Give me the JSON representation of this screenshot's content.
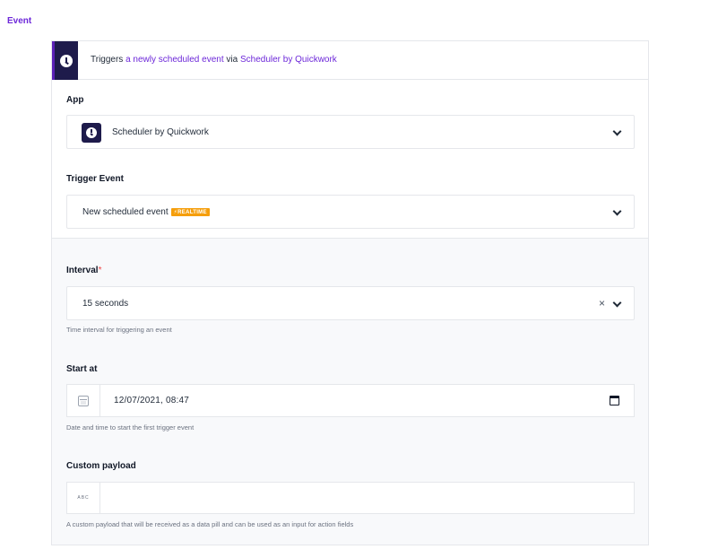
{
  "section_title": "Event",
  "trigger_header": {
    "prefix": "Triggers",
    "event_link": "a newly scheduled event",
    "via": "via",
    "app_link": "Scheduler by Quickwork",
    "logo_icon": "clock-icon"
  },
  "app": {
    "label": "App",
    "value": "Scheduler by Quickwork",
    "logo_icon": "clock-icon"
  },
  "trigger_event": {
    "label": "Trigger Event",
    "value": "New scheduled event",
    "badge": "REALTIME",
    "badge_icon": "lightning-icon",
    "badge_color": "#f59e0b"
  },
  "interval": {
    "label": "Interval",
    "required_mark": "*",
    "value": "15 seconds",
    "clear": "×",
    "help": "Time interval for triggering an event"
  },
  "start_at": {
    "label": "Start at",
    "value": "12/07/2021, 08:47",
    "help": "Date and time to start the first trigger event"
  },
  "custom_payload": {
    "label": "Custom payload",
    "prefix": "ABC",
    "value": "",
    "placeholder": "",
    "help": "A custom payload that will be received as a data pill and can be used as an input for action fields"
  },
  "colors": {
    "accent": "#6d28d9",
    "logo_bg": "#1e1b4b",
    "required": "#ef4444"
  }
}
